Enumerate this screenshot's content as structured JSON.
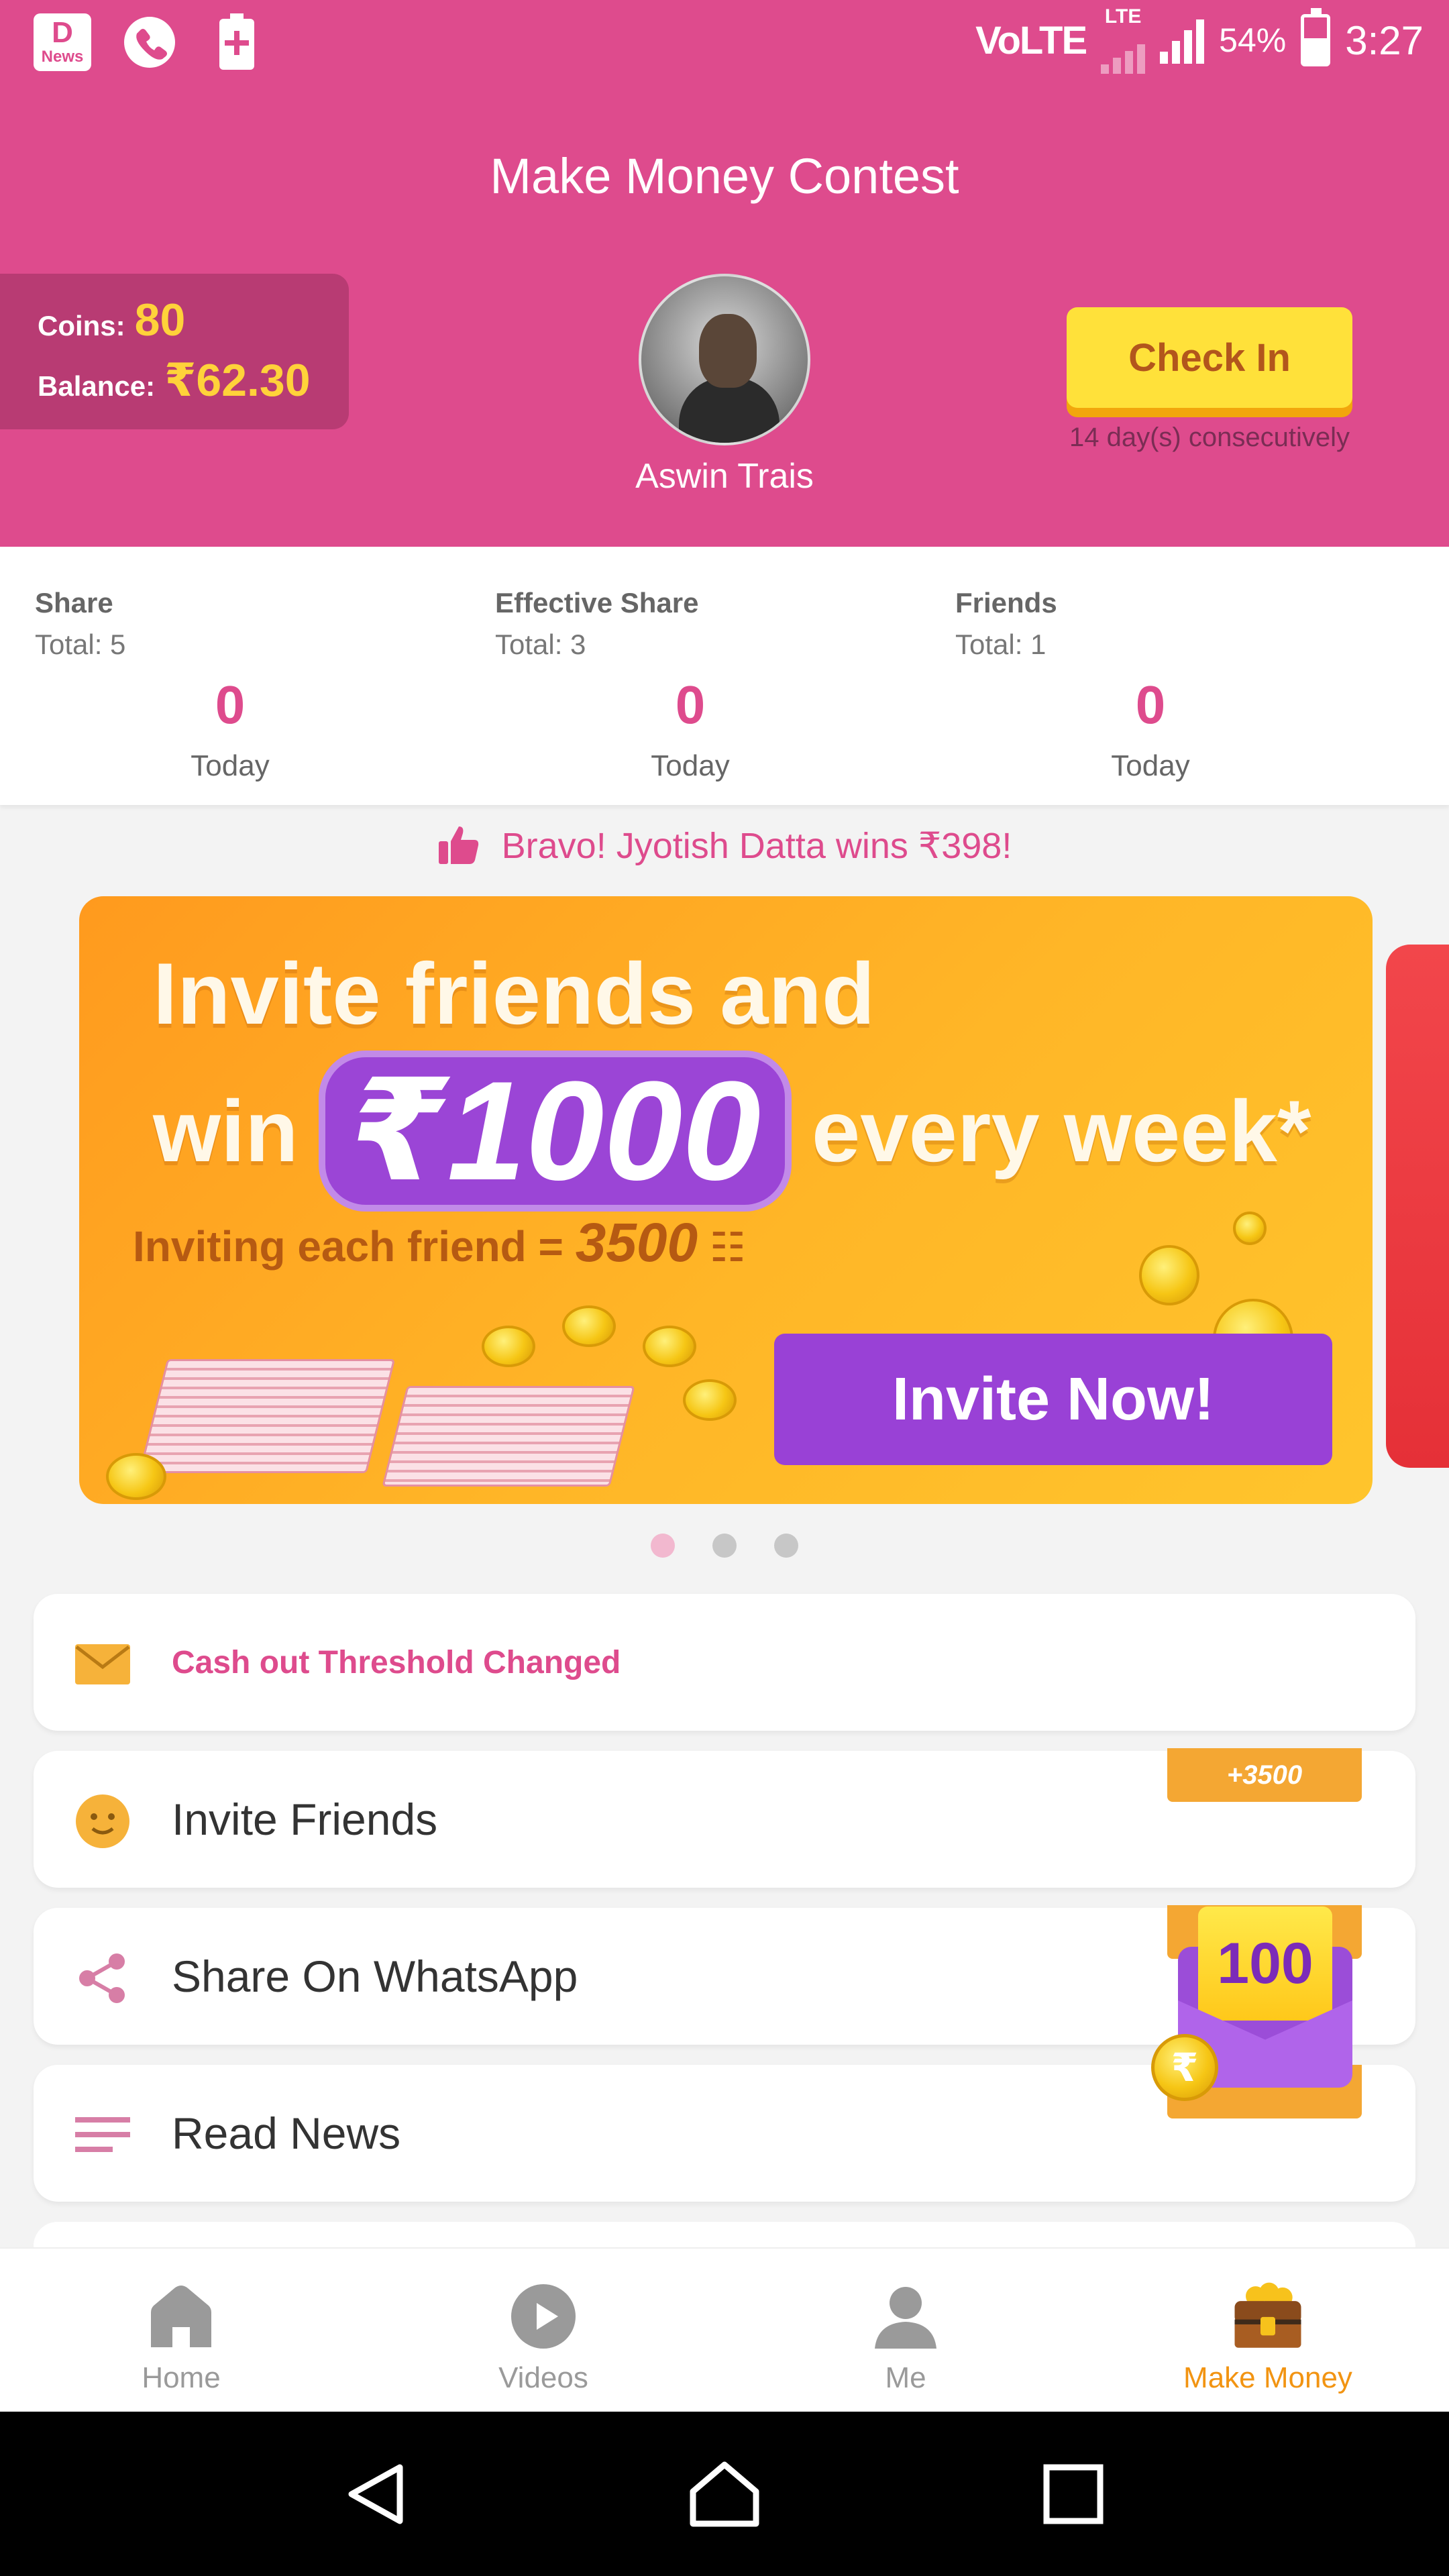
{
  "status_bar": {
    "left_icons": [
      "news-app-icon",
      "phone-icon",
      "battery-saver-icon"
    ],
    "news_label": "News",
    "network": "VoLTE",
    "lte": "LTE",
    "battery_percent": "54%",
    "time": "3:27"
  },
  "header": {
    "title": "Make Money Contest",
    "coins_label": "Coins:",
    "coins_value": "80",
    "balance_label": "Balance:",
    "balance_value": "₹62.30",
    "username": "Aswin Trais",
    "checkin_label": "Check In",
    "streak_text": "14 day(s) consecutively"
  },
  "stats": [
    {
      "title": "Share",
      "total": "Total: 5",
      "today_value": "0",
      "today_label": "Today"
    },
    {
      "title": "Effective Share",
      "total": "Total: 3",
      "today_value": "0",
      "today_label": "Today"
    },
    {
      "title": "Friends",
      "total": "Total: 1",
      "today_value": "0",
      "today_label": "Today"
    }
  ],
  "ticker": {
    "icon": "thumbs-up-icon",
    "text": "Bravo! Jyotish Datta wins ₹398!"
  },
  "banner": {
    "line1": "Invite friends and",
    "win": "win",
    "amount": "₹1000",
    "every_week": "every week*",
    "sub_text": "Inviting each friend =",
    "sub_value": "3500",
    "cta": "Invite Now!",
    "carousel_active_index": 0,
    "carousel_count": 3
  },
  "list": [
    {
      "icon": "mail-icon",
      "label": "Cash out Threshold Changed",
      "badge": ""
    },
    {
      "icon": "smiley-icon",
      "label": "Invite Friends",
      "badge": "+3500"
    },
    {
      "icon": "share-icon",
      "label": "Share On WhatsApp",
      "badge": ""
    },
    {
      "icon": "list-lines-icon",
      "label": "Read News",
      "badge": ""
    }
  ],
  "floating_reward": {
    "value": "100",
    "coin_symbol": "₹"
  },
  "bottom_nav": [
    {
      "icon": "home-icon",
      "label": "Home",
      "active": false
    },
    {
      "icon": "play-icon",
      "label": "Videos",
      "active": false
    },
    {
      "icon": "person-icon",
      "label": "Me",
      "active": false
    },
    {
      "icon": "treasure-chest-icon",
      "label": "Make Money",
      "active": true
    }
  ],
  "colors": {
    "brand_pink": "#de4b8d",
    "coin_yellow": "#ffd23a",
    "checkin_yellow": "#ffe13a",
    "banner_orange": "#ffb627",
    "cta_purple": "#9941d6",
    "nav_active": "#f29412"
  }
}
